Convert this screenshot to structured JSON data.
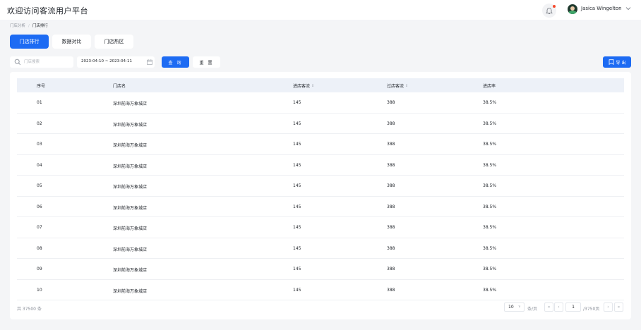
{
  "header": {
    "title": "欢迎访问客流用户平台",
    "user_name": "Jasica Wingelton"
  },
  "breadcrumb": [
    "门店分析",
    "门店排行"
  ],
  "tabs": [
    {
      "label": "门店排行",
      "active": true
    },
    {
      "label": "数据对比",
      "active": false
    },
    {
      "label": "门店热区",
      "active": false
    }
  ],
  "filters": {
    "search_placeholder": "门店搜索",
    "date_range": "2023-04-10 ~ 2023-04-11",
    "query_label": "查 询",
    "reset_label": "重 置",
    "export_label": "导 出"
  },
  "table": {
    "columns": [
      "序号",
      "门店名",
      "进店客流",
      "过店客流",
      "进店率"
    ],
    "rows": [
      [
        "01",
        "深圳前海万象城店",
        "145",
        "388",
        "38.5%"
      ],
      [
        "02",
        "深圳前海万象城店",
        "145",
        "388",
        "38.5%"
      ],
      [
        "03",
        "深圳前海万象城店",
        "145",
        "388",
        "38.5%"
      ],
      [
        "04",
        "深圳前海万象城店",
        "145",
        "388",
        "38.5%"
      ],
      [
        "05",
        "深圳前海万象城店",
        "145",
        "388",
        "38.5%"
      ],
      [
        "06",
        "深圳前海万象城店",
        "145",
        "388",
        "38.5%"
      ],
      [
        "07",
        "深圳前海万象城店",
        "145",
        "388",
        "38.5%"
      ],
      [
        "08",
        "深圳前海万象城店",
        "145",
        "388",
        "38.5%"
      ],
      [
        "09",
        "深圳前海万象城店",
        "145",
        "388",
        "38.5%"
      ],
      [
        "10",
        "深圳前海万象城店",
        "145",
        "388",
        "38.5%"
      ]
    ]
  },
  "pagination": {
    "total_text": "共 37500 条",
    "page_size": "10",
    "page_size_unit": "条/页",
    "current_page": "1",
    "total_pages": "/3750页"
  },
  "colors": {
    "primary": "#1d6bf3",
    "header_row": "#edf1f8",
    "page_bg": "#f4f5f7",
    "notification_dot": "#f5492c"
  },
  "icons": [
    "bell-icon",
    "chevron-down-icon",
    "search-icon",
    "calendar-icon",
    "export-icon",
    "first-page-icon",
    "prev-page-icon",
    "next-page-icon",
    "last-page-icon"
  ]
}
